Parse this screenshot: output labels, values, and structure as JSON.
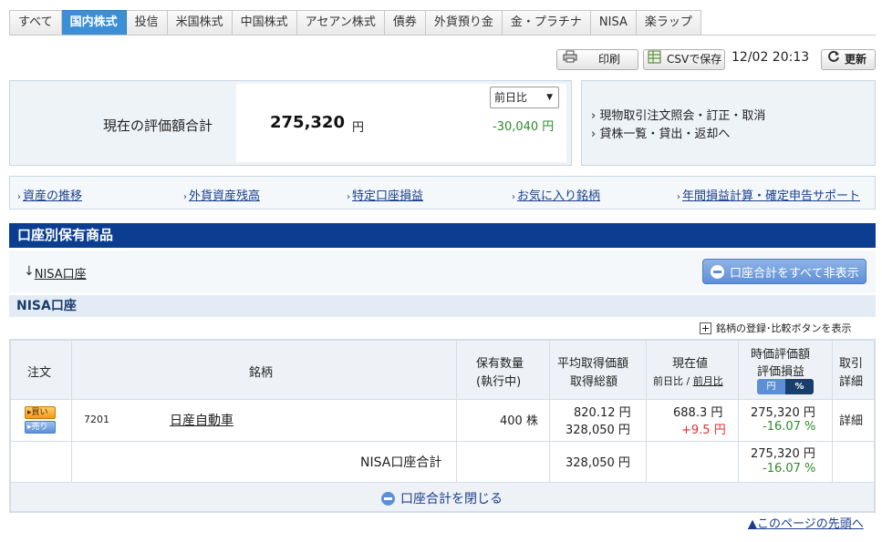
{
  "tabs": [
    {
      "label": "すべて",
      "active": false
    },
    {
      "label": "国内株式",
      "active": true
    },
    {
      "label": "投信",
      "active": false
    },
    {
      "label": "米国株式",
      "active": false
    },
    {
      "label": "中国株式",
      "active": false
    },
    {
      "label": "アセアン株式",
      "active": false
    },
    {
      "label": "債券",
      "active": false
    },
    {
      "label": "外貨預り金",
      "active": false
    },
    {
      "label": "金・プラチナ",
      "active": false
    },
    {
      "label": "NISA",
      "active": false
    },
    {
      "label": "楽ラップ",
      "active": false
    }
  ],
  "toolbar": {
    "print_label": "印刷",
    "csv_label": "CSVで保存",
    "timestamp": "12/02 20:13",
    "refresh_label": "更新"
  },
  "summary": {
    "label": "現在の評価額合計",
    "value": "275,320",
    "unit": "円",
    "compare_selected": "前日比",
    "diff": "-30,040 円"
  },
  "side_links": [
    "現物取引注文照会・訂正・取消",
    "貸株一覧・貸出・返却へ"
  ],
  "link_bar": [
    "資産の推移",
    "外貨資産残高",
    "特定口座損益",
    "お気に入り銘柄",
    "年間損益計算・確定申告サポート"
  ],
  "section": {
    "title": "口座別保有商品",
    "anchor_arrow": "↓",
    "anchor_label": "NISA口座",
    "hide_all_label": "口座合計をすべて非表示",
    "subsection_title": "NISA口座",
    "register_toggle_label": "銘柄の登録･比較ボタンを表示"
  },
  "table": {
    "headers": {
      "order": "注文",
      "name": "銘柄",
      "qty_1": "保有数量",
      "qty_2": "(執行中)",
      "avg_1": "平均取得価額",
      "avg_2": "取得総額",
      "price_1": "現在値",
      "price_2a": "前日比",
      "price_sep": " / ",
      "price_2b": "前月比",
      "pl_1": "時価評価額",
      "pl_2": "評価損益",
      "pl_toggle_yen": "円",
      "pl_toggle_pct": "%",
      "detail_1": "取引",
      "detail_2": "詳細"
    },
    "rows": [
      {
        "buy": "▸買い",
        "sell": "▸売り",
        "code": "7201",
        "name": "日産自動車",
        "qty": "400 株",
        "avg_price": "820.12 円",
        "total_cost": "328,050 円",
        "current_price": "688.3 円",
        "day_change": "+9.5 円",
        "market_value": "275,320 円",
        "pl_pct": "-16.07 %",
        "detail": "詳細"
      }
    ],
    "total": {
      "label": "NISA口座合計",
      "total_cost": "328,050 円",
      "market_value": "275,320 円",
      "pl_pct": "-16.07 %"
    },
    "close_label": "口座合計を閉じる"
  },
  "footer": {
    "page_top": "▲このページの先頭へ"
  },
  "colors": {
    "active_tab": "#3a8fd6",
    "header_navy": "#0b3d91",
    "loss_green": "#2e8b2e",
    "gain_red": "#e03030"
  }
}
